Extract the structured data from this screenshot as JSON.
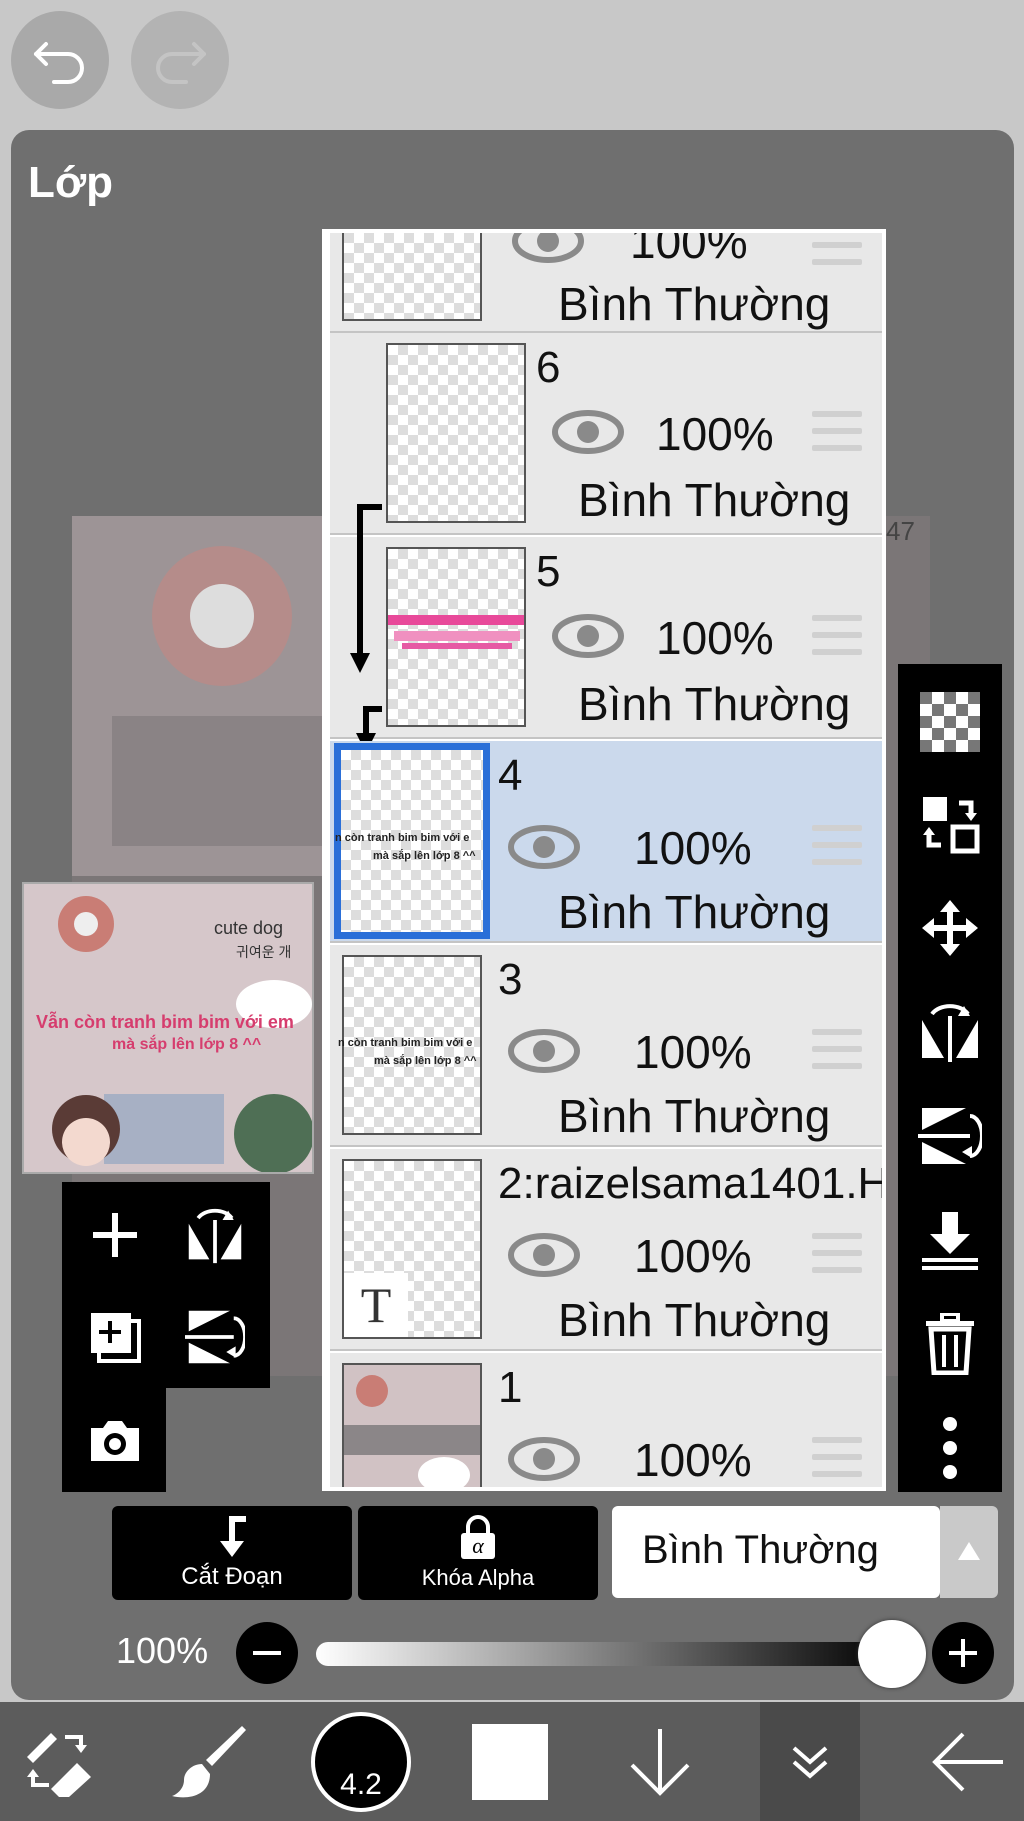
{
  "panel": {
    "title": "Lớp"
  },
  "canvas": {
    "corner_text": "47"
  },
  "thumbnail": {
    "line1": "Vẫn còn tranh bim bim với em",
    "line2": "mà sắp lên lớp 8 ^^",
    "small_text": "cute dog",
    "korean": "귀여운 개"
  },
  "layers": [
    {
      "name": "",
      "opacity": "100%",
      "mode": "Bình Thường"
    },
    {
      "name": "6",
      "opacity": "100%",
      "mode": "Bình Thường"
    },
    {
      "name": "5",
      "opacity": "100%",
      "mode": "Bình Thường"
    },
    {
      "name": "4",
      "opacity": "100%",
      "mode": "Bình Thường",
      "thumb_line1": "n còn tranh bim bim với e",
      "thumb_line2": "mà sắp lên lớp 8 ^^"
    },
    {
      "name": "3",
      "opacity": "100%",
      "mode": "Bình Thường",
      "thumb_line1": "n còn tranh bim bim với e",
      "thumb_line2": "mà sắp lên lớp 8 ^^"
    },
    {
      "name": "2:raizelsama1401.H",
      "opacity": "100%",
      "mode": "Bình Thường",
      "thumb_glyph": "T"
    },
    {
      "name": "1",
      "opacity": "100%",
      "mode": ""
    }
  ],
  "controls": {
    "clip_label": "Cắt Đoạn",
    "alpha_lock_label": "Khóa Alpha",
    "blend_mode": "Bình Thường",
    "opacity": "100%"
  },
  "brush": {
    "size": "4.2"
  },
  "colors": {
    "selected_layer": "#cbd9ec",
    "selection_border": "#2a6fd8",
    "panel_bg": "#6f6f6f"
  }
}
